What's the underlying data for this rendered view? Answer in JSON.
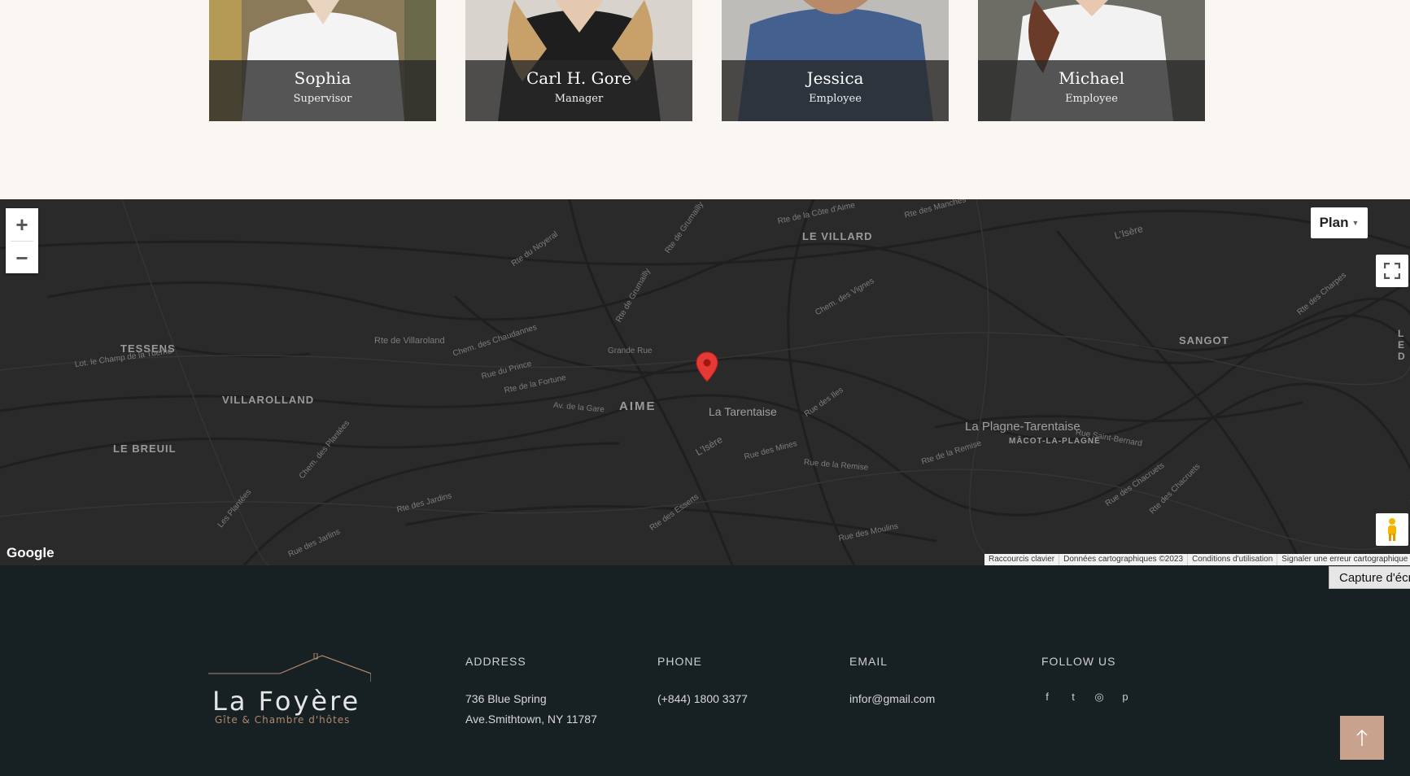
{
  "team": [
    {
      "name": "Sophia",
      "role": "Supervisor"
    },
    {
      "name": "Carl H. Gore",
      "role": "Manager"
    },
    {
      "name": "Jessica",
      "role": "Employee"
    },
    {
      "name": "Michael",
      "role": "Employee"
    }
  ],
  "map": {
    "places": {
      "le_villard": "LE VILLARD",
      "tessens": "TESSENS",
      "villarolland": "VILLAROLLAND",
      "le_breuil": "LE BREUIL",
      "aime": "AIME",
      "la_tarentaise": "La Tarentaise",
      "sangot": "SANGOT",
      "la_plagne": "La Plagne-Tarentaise",
      "macot": "MÂCOT-LA-PLAGNE",
      "edge_right": "LE D"
    },
    "roads": {
      "noyeral": "Rte du Noyeral",
      "villaroland": "Rte de Villaroland",
      "chaudannes": "Chem. des Chaudannes",
      "grande_rue": "Grande Rue",
      "prince": "Rue du Prince",
      "fortune": "Rte de la Fortune",
      "gare": "Av. de la Gare",
      "champ": "Lot. le Champ de la Tuerne",
      "plantees": "Chem. des Plantées",
      "les_plantees": "Les Plantées",
      "jardins": "Rte des Jardins",
      "jarlins": "Rue des Jarlins",
      "esserts": "Rte des Esserts",
      "mines": "Rue des Mines",
      "remise": "Rue de la Remise",
      "remise2": "Rte de la Remise",
      "iles": "Rue des Iles",
      "isere": "L'Isère",
      "isere2": "L'Isère",
      "moulins": "Rue des Moulins",
      "vignes": "Chem. des Vignes",
      "grumailly": "Rte de Grumailly",
      "grumailly2": "Rte de Grumailly",
      "cote": "Rte de la Côte d'Aime",
      "manches": "Rte des Manches",
      "charpes": "Rte des Charpes",
      "chacruets": "Rue des Chacruets",
      "chacruets2": "Rte des Chacruets",
      "saint_bernard": "Rue Saint-Bernard"
    },
    "zoom_in": "+",
    "zoom_out": "−",
    "map_type": "Plan",
    "google": "Google",
    "attribution": [
      "Raccourcis clavier",
      "Données cartographiques ©2023",
      "Conditions d'utilisation",
      "Signaler une erreur cartographique"
    ]
  },
  "capture_tooltip": "Capture d'écr",
  "footer": {
    "logo_title": "La Foyère",
    "logo_subtitle": "Gîte & Chambre d'hôtes",
    "address_heading": "ADDRESS",
    "address_line1": "736 Blue Spring",
    "address_line2": "Ave.Smithtown, NY 11787",
    "phone_heading": "PHONE",
    "phone": "(+844) 1800 3377",
    "email_heading": "EMAIL",
    "email": "infor@gmail.com",
    "follow_heading": "FOLLOW US",
    "social": [
      "f",
      "t",
      "◎",
      "p"
    ]
  },
  "colors": {
    "page_bg": "#faf6f2",
    "map_bg": "#2a2a2a",
    "footer_bg": "#172123",
    "accent": "#c9a28d",
    "marker": "#e53935"
  }
}
